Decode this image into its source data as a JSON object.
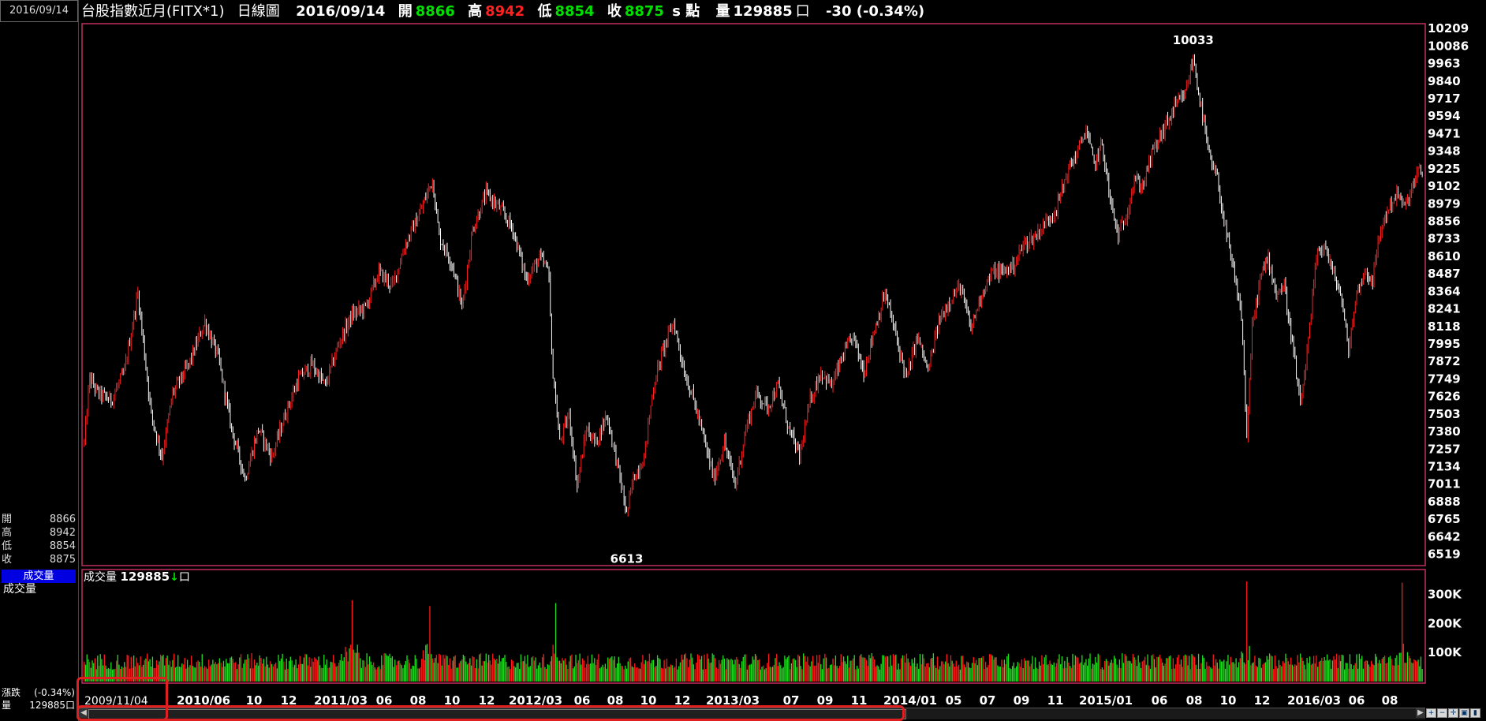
{
  "left_panel": {
    "date": "2016/09/14",
    "ohlc": [
      {
        "label": "開",
        "value": "8866"
      },
      {
        "label": "高",
        "value": "8942"
      },
      {
        "label": "低",
        "value": "8854"
      },
      {
        "label": "收",
        "value": "8875"
      }
    ],
    "selected_indicator": "成交量",
    "indicator": "成交量",
    "change_label": "漲跌",
    "change_value": "(-0.34%)",
    "volume_label": "量",
    "volume_value": "129885口"
  },
  "header": {
    "title": "台股指數近月(FITX*1)",
    "chart_kind": "日線圖",
    "date": "2016/09/14",
    "open_label": "開",
    "open_value": "8866",
    "high_label": "高",
    "high_value": "8942",
    "low_label": "低",
    "low_value": "8854",
    "close_label": "收",
    "close_value": "8875",
    "unit": "s 點",
    "volume_label": "量",
    "volume_value": "129885",
    "volume_unit": "口",
    "change": "-30 (-0.34%)"
  },
  "volume_panel": {
    "label": "成交量",
    "value": "129885",
    "arrow": "↓",
    "unit": "口"
  },
  "colors": {
    "up": "#ff2020",
    "down": "#ffffff",
    "vol_up": "#ff1a1a",
    "vol_down": "#22dd22",
    "frame": "#c03060",
    "x_major": "#ffff40"
  },
  "chart_data": [
    {
      "type": "candlestick",
      "title": "台股指數近月(FITX*1) 日線圖",
      "y_ticks": [
        10209,
        10086,
        9963,
        9840,
        9717,
        9594,
        9471,
        9348,
        9225,
        9102,
        8979,
        8856,
        8733,
        8610,
        8487,
        8364,
        8241,
        8118,
        7995,
        7872,
        7749,
        7626,
        7503,
        7380,
        7257,
        7134,
        7011,
        6888,
        6765,
        6642,
        6519
      ],
      "ylim": [
        6450,
        10232
      ],
      "annotations": [
        {
          "text": "10033",
          "x": "2015/04",
          "y": 10033
        },
        {
          "text": "6613",
          "x": "2011/12",
          "y": 6613
        }
      ],
      "x_ticks": [
        {
          "label": "2009/11/04",
          "major": false,
          "start": true
        },
        {
          "label": "2010/06",
          "major": true
        },
        {
          "label": "10",
          "major": false
        },
        {
          "label": "12",
          "major": false
        },
        {
          "label": "2011/03",
          "major": true
        },
        {
          "label": "06",
          "major": false
        },
        {
          "label": "08",
          "major": false
        },
        {
          "label": "10",
          "major": false
        },
        {
          "label": "12",
          "major": false
        },
        {
          "label": "2012/03",
          "major": true
        },
        {
          "label": "06",
          "major": false
        },
        {
          "label": "08",
          "major": false
        },
        {
          "label": "10",
          "major": false
        },
        {
          "label": "12",
          "major": false
        },
        {
          "label": "2013/03",
          "major": true
        },
        {
          "label": "07",
          "major": false
        },
        {
          "label": "09",
          "major": false
        },
        {
          "label": "11",
          "major": false
        },
        {
          "label": "2014/01",
          "major": true
        },
        {
          "label": "05",
          "major": false
        },
        {
          "label": "07",
          "major": false
        },
        {
          "label": "09",
          "major": false
        },
        {
          "label": "11",
          "major": false
        },
        {
          "label": "2015/01",
          "major": true
        },
        {
          "label": "06",
          "major": false
        },
        {
          "label": "08",
          "major": false
        },
        {
          "label": "10",
          "major": false
        },
        {
          "label": "12",
          "major": false
        },
        {
          "label": "2016/03",
          "major": true
        },
        {
          "label": "06",
          "major": false
        },
        {
          "label": "08",
          "major": false
        }
      ],
      "trend": [
        [
          0,
          7300
        ],
        [
          4,
          7760
        ],
        [
          10,
          7650
        ],
        [
          20,
          7600
        ],
        [
          30,
          7800
        ],
        [
          40,
          8350
        ],
        [
          50,
          7500
        ],
        [
          58,
          7200
        ],
        [
          66,
          7650
        ],
        [
          78,
          7850
        ],
        [
          90,
          8150
        ],
        [
          100,
          7900
        ],
        [
          110,
          7400
        ],
        [
          120,
          7050
        ],
        [
          130,
          7400
        ],
        [
          140,
          7200
        ],
        [
          150,
          7500
        ],
        [
          160,
          7750
        ],
        [
          170,
          7850
        ],
        [
          180,
          7700
        ],
        [
          190,
          8000
        ],
        [
          200,
          8200
        ],
        [
          210,
          8250
        ],
        [
          220,
          8500
        ],
        [
          230,
          8400
        ],
        [
          240,
          8700
        ],
        [
          250,
          8900
        ],
        [
          260,
          9150
        ],
        [
          265,
          8750
        ],
        [
          275,
          8550
        ],
        [
          282,
          8250
        ],
        [
          290,
          8800
        ],
        [
          300,
          9050
        ],
        [
          310,
          8950
        ],
        [
          320,
          8800
        ],
        [
          330,
          8450
        ],
        [
          340,
          8600
        ],
        [
          347,
          8500
        ],
        [
          349,
          7900
        ],
        [
          355,
          7300
        ],
        [
          362,
          7500
        ],
        [
          368,
          7000
        ],
        [
          375,
          7400
        ],
        [
          382,
          7300
        ],
        [
          390,
          7500
        ],
        [
          398,
          7150
        ],
        [
          405,
          6800
        ],
        [
          410,
          7050
        ],
        [
          418,
          7200
        ],
        [
          425,
          7700
        ],
        [
          432,
          7950
        ],
        [
          440,
          8150
        ],
        [
          448,
          7800
        ],
        [
          455,
          7600
        ],
        [
          462,
          7350
        ],
        [
          470,
          7050
        ],
        [
          478,
          7300
        ],
        [
          486,
          7000
        ],
        [
          494,
          7400
        ],
        [
          502,
          7650
        ],
        [
          510,
          7550
        ],
        [
          518,
          7700
        ],
        [
          526,
          7400
        ],
        [
          534,
          7200
        ],
        [
          542,
          7600
        ],
        [
          550,
          7800
        ],
        [
          558,
          7700
        ],
        [
          566,
          7900
        ],
        [
          574,
          8050
        ],
        [
          582,
          7800
        ],
        [
          590,
          8100
        ],
        [
          598,
          8350
        ],
        [
          606,
          8050
        ],
        [
          614,
          7750
        ],
        [
          622,
          8050
        ],
        [
          630,
          7800
        ],
        [
          638,
          8150
        ],
        [
          646,
          8300
        ],
        [
          654,
          8400
        ],
        [
          662,
          8100
        ],
        [
          670,
          8350
        ],
        [
          678,
          8500
        ],
        [
          686,
          8500
        ],
        [
          694,
          8550
        ],
        [
          702,
          8700
        ],
        [
          710,
          8750
        ],
        [
          718,
          8850
        ],
        [
          726,
          8950
        ],
        [
          734,
          9200
        ],
        [
          742,
          9350
        ],
        [
          748,
          9500
        ],
        [
          754,
          9250
        ],
        [
          760,
          9400
        ],
        [
          766,
          9000
        ],
        [
          772,
          8750
        ],
        [
          778,
          8900
        ],
        [
          784,
          9150
        ],
        [
          790,
          9100
        ],
        [
          798,
          9350
        ],
        [
          806,
          9500
        ],
        [
          814,
          9650
        ],
        [
          822,
          9750
        ],
        [
          828,
          10000
        ],
        [
          834,
          9650
        ],
        [
          840,
          9300
        ],
        [
          846,
          9150
        ],
        [
          852,
          8800
        ],
        [
          858,
          8500
        ],
        [
          864,
          8200
        ],
        [
          868,
          7350
        ],
        [
          872,
          8100
        ],
        [
          878,
          8450
        ],
        [
          884,
          8600
        ],
        [
          890,
          8350
        ],
        [
          896,
          8400
        ],
        [
          902,
          8000
        ],
        [
          908,
          7550
        ],
        [
          914,
          8000
        ],
        [
          920,
          8600
        ],
        [
          926,
          8700
        ],
        [
          932,
          8500
        ],
        [
          938,
          8350
        ],
        [
          944,
          7950
        ],
        [
          950,
          8350
        ],
        [
          956,
          8500
        ],
        [
          962,
          8450
        ],
        [
          968,
          8800
        ],
        [
          974,
          8950
        ],
        [
          980,
          9050
        ],
        [
          986,
          8950
        ],
        [
          992,
          9100
        ],
        [
          996,
          9200
        ]
      ],
      "n_bars": 1000
    },
    {
      "type": "bar",
      "title": "成交量",
      "y_ticks": [
        "300K",
        "200K",
        "100K"
      ],
      "ylim": [
        0,
        380000
      ],
      "typical": 75000,
      "peaks": [
        {
          "x": 200,
          "value": 280000
        },
        {
          "x": 258,
          "value": 260000
        },
        {
          "x": 352,
          "value": 270000
        },
        {
          "x": 868,
          "value": 345000
        },
        {
          "x": 984,
          "value": 340000
        }
      ]
    }
  ]
}
